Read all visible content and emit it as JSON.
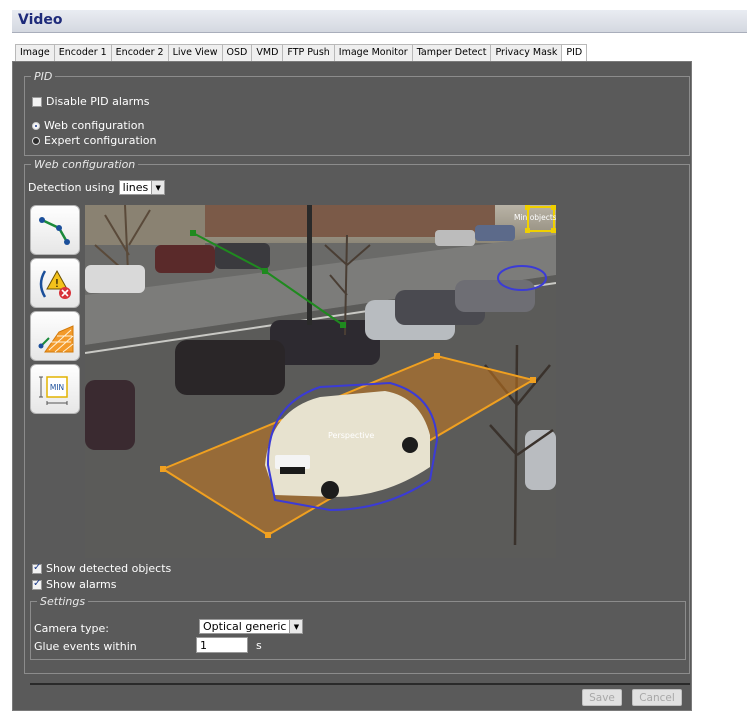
{
  "window": {
    "title": "Video"
  },
  "tabs": [
    "Image",
    "Encoder 1",
    "Encoder 2",
    "Live View",
    "OSD",
    "VMD",
    "FTP Push",
    "Image Monitor",
    "Tamper Detect",
    "Privacy Mask",
    "PID"
  ],
  "active_tab": "PID",
  "pid": {
    "legend": "PID",
    "disable_alarms_label": "Disable PID alarms",
    "web_config_label": "Web configuration",
    "expert_config_label": "Expert configuration"
  },
  "web_config": {
    "legend": "Web configuration",
    "detection_label": "Detection using",
    "detection_value": "lines",
    "tools": [
      "line-tool-icon",
      "alarm-rule-icon",
      "perspective-tool-icon",
      "min-object-icon"
    ],
    "tool_min_text": "MIN",
    "overlay_min_objects": "Min objects",
    "overlay_perspective": "Perspective",
    "show_detected_label": "Show detected objects",
    "show_alarms_label": "Show alarms"
  },
  "settings": {
    "legend": "Settings",
    "camera_type_label": "Camera type:",
    "camera_type_value": "Optical generic",
    "glue_label": "Glue events within",
    "glue_value": "1",
    "glue_unit": "s"
  },
  "buttons": {
    "save": "Save",
    "cancel": "Cancel"
  },
  "colors": {
    "title": "#1e2b7a",
    "line_overlay": "#1f8a1f",
    "perspective": "#f0a020",
    "object_outline": "#3b3bd6"
  }
}
